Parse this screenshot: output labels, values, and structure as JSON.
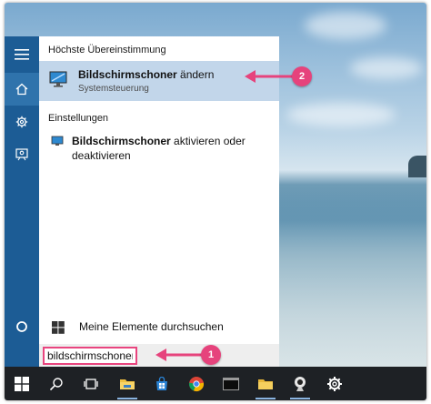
{
  "start_menu": {
    "best_match_heading": "Höchste Übereinstimmung",
    "best_match": {
      "title_bold": "Bildschirmschoner",
      "title_rest": " ändern",
      "subtitle": "Systemsteuerung"
    },
    "settings_heading": "Einstellungen",
    "setting_item": {
      "title_bold": "Bildschirmschoner",
      "title_rest": " aktivieren oder deaktivieren"
    },
    "my_items_label": "Meine Elemente durchsuchen",
    "search": {
      "value": "bildschirmschoner",
      "placeholder": ""
    }
  },
  "annotations": {
    "callout_1": "1",
    "callout_2": "2"
  },
  "colors": {
    "rail": "#1c5c95",
    "highlight": "#c2d6ea",
    "accent": "#e6437c",
    "taskbar": "#1e2125"
  },
  "taskbar_icons": [
    "windows-logo-icon",
    "search-icon",
    "task-view-icon",
    "file-explorer-icon",
    "store-icon",
    "chrome-icon",
    "terminal-icon",
    "folder-icon",
    "webcam-icon",
    "settings-gear-icon"
  ]
}
